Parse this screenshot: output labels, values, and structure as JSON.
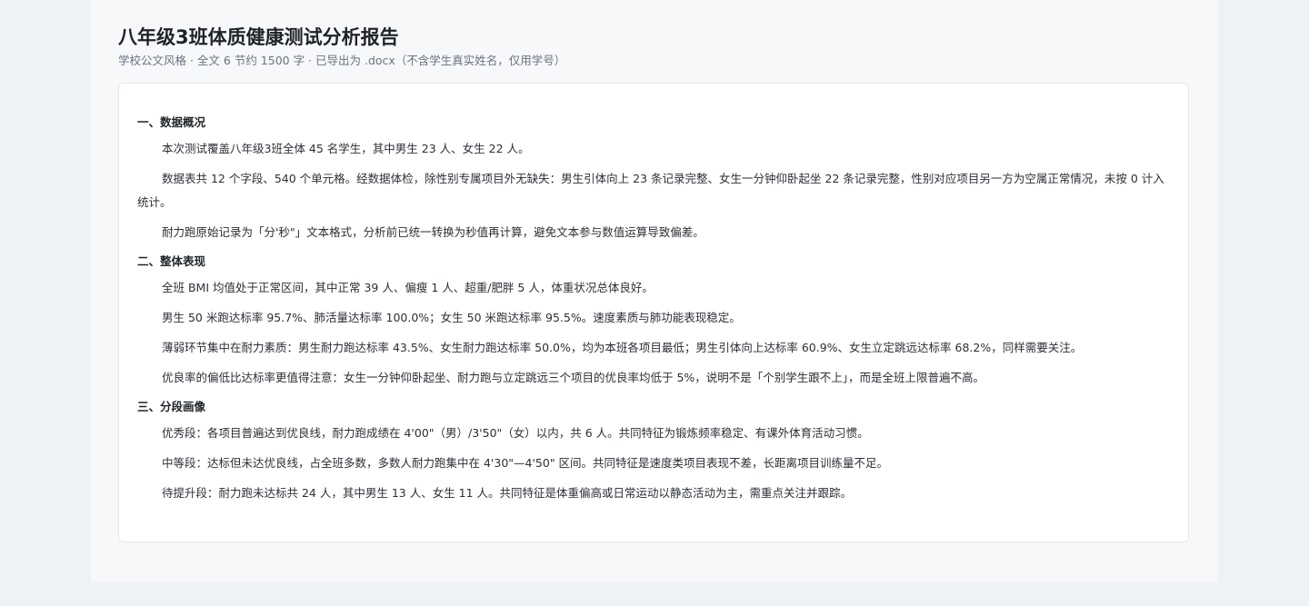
{
  "report": {
    "title": "八年级3班体质健康测试分析报告",
    "subtitle": "学校公文风格 · 全文 6 节约 1500 字 · 已导出为 .docx（不含学生真实姓名，仅用学号）"
  },
  "sections": [
    {
      "heading": "一、数据概况",
      "paragraphs": [
        "本次测试覆盖八年级3班全体 45 名学生，其中男生 23 人、女生 22 人。",
        "数据表共 12 个字段、540 个单元格。经数据体检，除性别专属项目外无缺失：男生引体向上 23 条记录完整、女生一分钟仰卧起坐 22 条记录完整，性别对应项目另一方为空属正常情况，未按 0 计入统计。",
        "耐力跑原始记录为「分'秒\"」文本格式，分析前已统一转换为秒值再计算，避免文本参与数值运算导致偏差。"
      ]
    },
    {
      "heading": "二、整体表现",
      "paragraphs": [
        "全班 BMI 均值处于正常区间，其中正常 39 人、偏瘦 1 人、超重/肥胖 5 人，体重状况总体良好。",
        "男生 50 米跑达标率 95.7%、肺活量达标率 100.0%；女生 50 米跑达标率 95.5%。速度素质与肺功能表现稳定。",
        "薄弱环节集中在耐力素质：男生耐力跑达标率 43.5%、女生耐力跑达标率 50.0%，均为本班各项目最低；男生引体向上达标率 60.9%、女生立定跳远达标率 68.2%，同样需要关注。",
        "优良率的偏低比达标率更值得注意：女生一分钟仰卧起坐、耐力跑与立定跳远三个项目的优良率均低于 5%，说明不是「个别学生跟不上」，而是全班上限普遍不高。"
      ]
    },
    {
      "heading": "三、分段画像",
      "paragraphs": [
        "优秀段：各项目普遍达到优良线，耐力跑成绩在 4'00\"（男）/3'50\"（女）以内，共 6 人。共同特征为锻炼频率稳定、有课外体育活动习惯。",
        "中等段：达标但未达优良线，占全班多数，多数人耐力跑集中在 4'30\"—4'50\" 区间。共同特征是速度类项目表现不差，长距离项目训练量不足。",
        "待提升段：耐力跑未达标共 24 人，其中男生 13 人、女生 11 人。共同特征是体重偏高或日常运动以静态活动为主，需重点关注并跟踪。"
      ]
    }
  ]
}
